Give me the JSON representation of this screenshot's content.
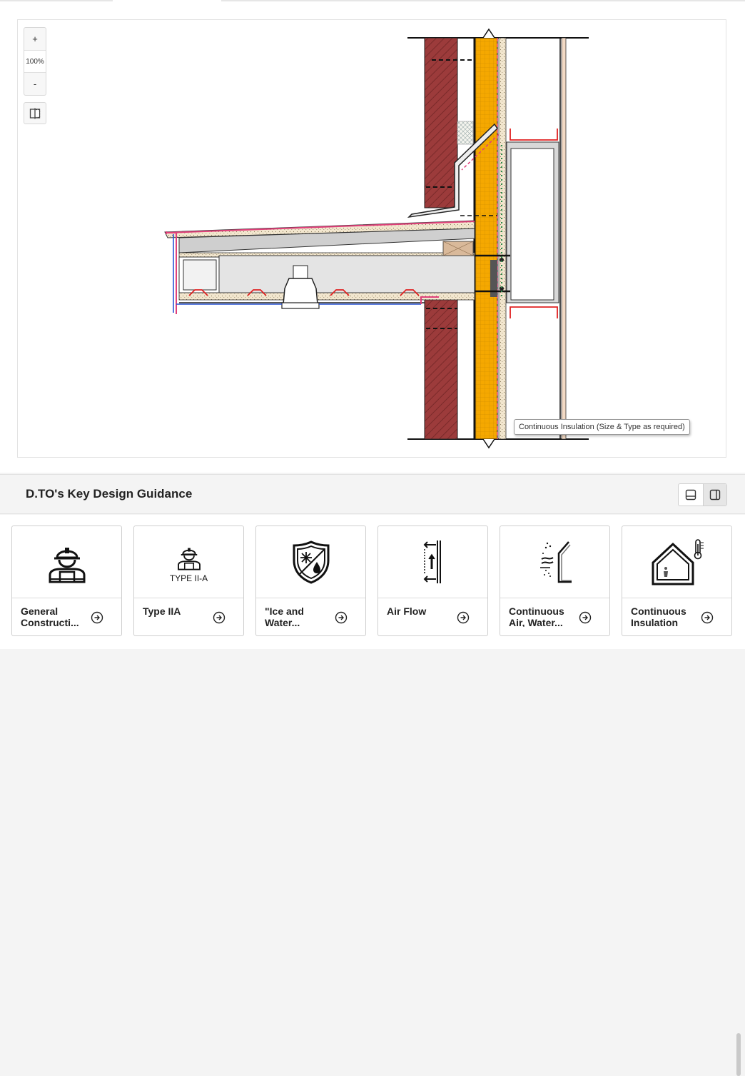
{
  "viewer": {
    "zoom_in_label": "+",
    "zoom_level": "100%",
    "zoom_out_label": "-",
    "split_view_icon": "split-view-icon",
    "tooltip": "Continuous Insulation (Size & Type as required)"
  },
  "guidance": {
    "title": "D.TO's Key Design Guidance",
    "layout_options": [
      "bottom-panel-icon",
      "side-panel-icon"
    ],
    "cards": [
      {
        "label": "General Constructi... Type",
        "icon": "construction-worker-icon"
      },
      {
        "label": "Type IIA",
        "icon": "construction-worker-icon",
        "icon_caption": "TYPE II-A"
      },
      {
        "label": "\"Ice and Water... Shield\"",
        "icon": "ice-water-shield-icon"
      },
      {
        "label": "Air Flow",
        "icon": "air-flow-icon"
      },
      {
        "label": "Continuous Air, Water... and Vapor",
        "icon": "air-water-barrier-icon"
      },
      {
        "label": "Continuous Insulation",
        "icon": "house-insulation-icon"
      }
    ]
  },
  "colors": {
    "brick": "#9c3b3b",
    "insulation": "#f5a800",
    "membrane": "#e0407a",
    "accent_red": "#e02020"
  }
}
